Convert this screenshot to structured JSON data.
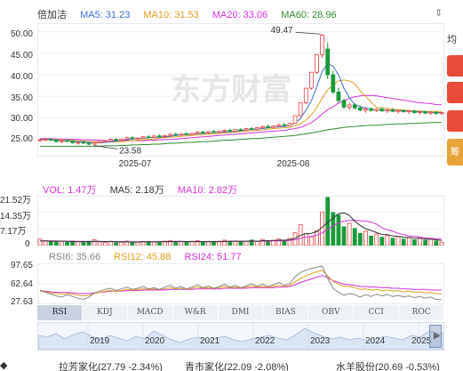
{
  "main_legend": {
    "name": "倍加洁",
    "items": [
      {
        "label": "MA5: 31.23",
        "color": "#3d6fd1"
      },
      {
        "label": "MA10: 31.53",
        "color": "#e0a020"
      },
      {
        "label": "MA20: 33.06",
        "color": "#d633d6"
      },
      {
        "label": "MA60: 28.96",
        "color": "#2f8a2f"
      }
    ]
  },
  "main_yaxis": [
    "50.00",
    "45.00",
    "40.00",
    "35.00",
    "30.00",
    "25.00"
  ],
  "main_xaxis": [
    "2025-07",
    "2025-08"
  ],
  "annotations": {
    "high": "49.47",
    "low": "23.58"
  },
  "watermark": "东方财富",
  "vol_legend": [
    {
      "label": "VOL: 1.47万",
      "color": "#d633d6"
    },
    {
      "label": "MA5: 2.18万",
      "color": "#333333"
    },
    {
      "label": "MA10: 2.82万",
      "color": "#d633d6"
    }
  ],
  "vol_yaxis": [
    "21.52万",
    "14.35万",
    "7.17万",
    "0"
  ],
  "rsi_legend": [
    {
      "label": "RSI6: 35.66",
      "color": "#888888"
    },
    {
      "label": "RSI12: 45.88",
      "color": "#e0a020"
    },
    {
      "label": "RSI24: 51.77",
      "color": "#d633d6"
    }
  ],
  "rsi_yaxis": [
    "97.65",
    "62.64",
    "27.63"
  ],
  "tabs": [
    "RSI",
    "KDJ",
    "MACD",
    "W&R",
    "DMI",
    "BIAS",
    "OBV",
    "CCI",
    "ROC"
  ],
  "navigator_years": [
    "2019",
    "2020",
    "2021",
    "2022",
    "2023",
    "2024",
    "2025"
  ],
  "side": {
    "label1": "均线",
    "label2": "筹"
  },
  "bottom": {
    "item1": "拉芳家化(27.79 -2.34%)",
    "item2": "青市家化(22.09 -2.08%)",
    "item3": "水羊股份(20.69 -0.53%)"
  },
  "chart_data": {
    "type": "candlestick",
    "ylim": [
      21,
      52
    ],
    "xlabels": [
      "2025-07",
      "2025-08"
    ],
    "candles": [
      [
        24.8,
        25.1,
        24.5,
        24.9
      ],
      [
        24.9,
        25.3,
        24.6,
        25.0
      ],
      [
        25.0,
        25.2,
        24.6,
        24.8
      ],
      [
        24.8,
        25.0,
        24.3,
        24.5
      ],
      [
        24.5,
        24.8,
        24.1,
        24.7
      ],
      [
        24.7,
        25.0,
        24.4,
        24.6
      ],
      [
        24.6,
        24.8,
        24.0,
        24.2
      ],
      [
        24.2,
        24.5,
        23.8,
        24.3
      ],
      [
        24.3,
        24.6,
        24.0,
        24.1
      ],
      [
        24.1,
        24.4,
        23.6,
        23.9
      ],
      [
        23.9,
        24.3,
        23.58,
        24.2
      ],
      [
        24.2,
        24.6,
        24.0,
        24.5
      ],
      [
        24.5,
        24.9,
        24.3,
        24.7
      ],
      [
        24.7,
        25.2,
        24.5,
        25.0
      ],
      [
        25.0,
        25.3,
        24.6,
        24.8
      ],
      [
        24.8,
        25.2,
        24.6,
        25.1
      ],
      [
        25.1,
        25.6,
        24.9,
        25.4
      ],
      [
        25.4,
        25.7,
        25.0,
        25.2
      ],
      [
        25.2,
        25.5,
        24.9,
        25.3
      ],
      [
        25.3,
        25.8,
        25.1,
        25.6
      ],
      [
        25.6,
        26.0,
        25.3,
        25.5
      ],
      [
        25.5,
        25.9,
        25.2,
        25.8
      ],
      [
        25.8,
        26.2,
        25.5,
        25.7
      ],
      [
        25.7,
        26.0,
        25.4,
        25.9
      ],
      [
        25.9,
        26.4,
        25.6,
        26.2
      ],
      [
        26.2,
        26.5,
        25.8,
        26.0
      ],
      [
        26.0,
        26.4,
        25.7,
        26.3
      ],
      [
        26.3,
        26.6,
        26.0,
        26.1
      ],
      [
        26.1,
        26.5,
        25.9,
        26.4
      ],
      [
        26.4,
        26.9,
        26.2,
        26.7
      ],
      [
        26.7,
        27.0,
        26.3,
        26.5
      ],
      [
        26.5,
        26.9,
        26.2,
        26.8
      ],
      [
        26.8,
        27.2,
        26.5,
        26.6
      ],
      [
        26.6,
        27.0,
        26.4,
        26.9
      ],
      [
        26.9,
        27.3,
        26.6,
        27.1
      ],
      [
        27.1,
        27.5,
        26.8,
        26.9
      ],
      [
        26.9,
        27.4,
        26.7,
        27.3
      ],
      [
        27.3,
        27.6,
        27.0,
        27.2
      ],
      [
        27.2,
        27.7,
        27.0,
        27.5
      ],
      [
        27.5,
        27.9,
        27.2,
        27.4
      ],
      [
        27.4,
        27.8,
        27.1,
        27.7
      ],
      [
        27.7,
        28.2,
        27.5,
        28.0
      ],
      [
        28.0,
        28.4,
        27.6,
        27.8
      ],
      [
        27.8,
        28.3,
        27.6,
        28.1
      ],
      [
        28.1,
        28.6,
        27.9,
        28.4
      ],
      [
        28.4,
        28.8,
        28.0,
        28.2
      ],
      [
        28.2,
        28.9,
        28.0,
        28.7
      ],
      [
        28.7,
        30.5,
        28.6,
        30.5
      ],
      [
        30.5,
        33.5,
        30.3,
        33.5
      ],
      [
        33.5,
        36.9,
        33.2,
        36.9
      ],
      [
        36.9,
        40.6,
        36.5,
        40.6
      ],
      [
        40.6,
        44.7,
        40.2,
        44.7
      ],
      [
        44.7,
        49.47,
        44.0,
        49.2
      ],
      [
        46.0,
        47.5,
        39.0,
        40.0
      ],
      [
        40.0,
        41.0,
        35.5,
        36.0
      ],
      [
        36.0,
        37.0,
        33.5,
        34.0
      ],
      [
        34.0,
        34.5,
        32.0,
        32.5
      ],
      [
        32.5,
        33.5,
        31.8,
        33.0
      ],
      [
        33.0,
        33.4,
        32.0,
        32.3
      ],
      [
        32.3,
        32.8,
        31.5,
        31.8
      ],
      [
        31.8,
        32.4,
        31.2,
        32.1
      ],
      [
        32.1,
        32.5,
        31.5,
        31.7
      ],
      [
        31.7,
        32.2,
        31.3,
        32.0
      ],
      [
        32.0,
        32.4,
        31.4,
        31.6
      ],
      [
        31.6,
        32.0,
        31.1,
        31.8
      ],
      [
        31.8,
        32.3,
        31.3,
        31.5
      ],
      [
        31.5,
        31.9,
        31.0,
        31.7
      ],
      [
        31.7,
        32.0,
        31.2,
        31.4
      ],
      [
        31.4,
        31.8,
        30.9,
        31.6
      ],
      [
        31.6,
        31.9,
        31.0,
        31.2
      ],
      [
        31.2,
        31.6,
        30.8,
        31.4
      ],
      [
        31.4,
        31.7,
        30.9,
        31.1
      ],
      [
        31.1,
        31.5,
        30.7,
        31.3
      ],
      [
        31.3,
        31.6,
        30.8,
        31.0
      ],
      [
        31.0,
        31.4,
        30.6,
        31.2
      ]
    ],
    "ma5": [
      25.0,
      24.9,
      24.9,
      24.8,
      24.7,
      24.7,
      24.6,
      24.5,
      24.4,
      24.3,
      24.2,
      24.2,
      24.3,
      24.4,
      24.6,
      24.8,
      24.9,
      25.1,
      25.2,
      25.3,
      25.4,
      25.5,
      25.5,
      25.6,
      25.7,
      25.9,
      26.0,
      26.1,
      26.2,
      26.3,
      26.4,
      26.5,
      26.6,
      26.6,
      26.7,
      26.8,
      26.9,
      27.0,
      27.2,
      27.3,
      27.4,
      27.5,
      27.7,
      27.8,
      27.9,
      28.0,
      28.2,
      28.8,
      29.9,
      31.8,
      34.0,
      37.2,
      40.8,
      42.6,
      42.0,
      40.0,
      36.9,
      34.7,
      33.1,
      32.6,
      32.3,
      32.0,
      31.9,
      31.8,
      31.8,
      31.7,
      31.7,
      31.6,
      31.6,
      31.5,
      31.4,
      31.4,
      31.3,
      31.2,
      31.2
    ],
    "ma10": [
      25.0,
      25.0,
      25.0,
      24.9,
      24.9,
      24.8,
      24.8,
      24.7,
      24.6,
      24.5,
      24.5,
      24.4,
      24.4,
      24.4,
      24.4,
      24.5,
      24.6,
      24.7,
      24.8,
      24.9,
      25.0,
      25.1,
      25.3,
      25.4,
      25.5,
      25.6,
      25.7,
      25.8,
      25.9,
      26.0,
      26.1,
      26.2,
      26.3,
      26.4,
      26.5,
      26.6,
      26.7,
      26.8,
      26.9,
      27.0,
      27.1,
      27.2,
      27.4,
      27.5,
      27.6,
      27.7,
      27.8,
      28.1,
      28.6,
      29.5,
      30.7,
      32.4,
      34.6,
      36.5,
      37.6,
      38.6,
      38.8,
      38.6,
      37.9,
      36.3,
      35.0,
      33.6,
      32.4,
      32.3,
      32.2,
      32.0,
      31.9,
      31.8,
      31.7,
      31.6,
      31.6,
      31.5,
      31.5,
      31.5,
      31.5
    ],
    "ma20": [
      25.2,
      25.2,
      25.2,
      25.1,
      25.1,
      25.1,
      25.0,
      25.0,
      24.9,
      24.9,
      24.8,
      24.8,
      24.7,
      24.7,
      24.7,
      24.7,
      24.7,
      24.7,
      24.7,
      24.7,
      24.8,
      24.8,
      24.9,
      24.9,
      25.0,
      25.1,
      25.2,
      25.3,
      25.4,
      25.5,
      25.6,
      25.7,
      25.8,
      25.9,
      26.0,
      26.1,
      26.2,
      26.3,
      26.4,
      26.5,
      26.6,
      26.7,
      26.8,
      26.9,
      27.0,
      27.1,
      27.3,
      27.5,
      27.8,
      28.3,
      28.9,
      29.8,
      30.9,
      31.9,
      32.6,
      33.4,
      34.0,
      34.5,
      34.9,
      35.1,
      35.2,
      35.2,
      35.1,
      34.9,
      34.7,
      34.5,
      34.3,
      34.1,
      33.9,
      33.7,
      33.5,
      33.4,
      33.3,
      33.1,
      33.06
    ],
    "ma60": [
      23.4,
      23.4,
      23.4,
      23.4,
      23.4,
      23.4,
      23.4,
      23.4,
      23.4,
      23.4,
      23.4,
      23.4,
      23.5,
      23.5,
      23.5,
      23.6,
      23.6,
      23.7,
      23.7,
      23.8,
      23.8,
      23.9,
      23.9,
      24.0,
      24.1,
      24.1,
      24.2,
      24.3,
      24.3,
      24.4,
      24.5,
      24.5,
      24.6,
      24.7,
      24.8,
      24.8,
      24.9,
      25.0,
      25.1,
      25.2,
      25.2,
      25.3,
      25.4,
      25.5,
      25.6,
      25.7,
      25.8,
      25.9,
      26.1,
      26.3,
      26.5,
      26.7,
      27.0,
      27.2,
      27.4,
      27.6,
      27.8,
      27.9,
      28.0,
      28.1,
      28.2,
      28.3,
      28.3,
      28.4,
      28.5,
      28.5,
      28.6,
      28.6,
      28.7,
      28.7,
      28.8,
      28.8,
      28.9,
      28.9,
      28.96
    ],
    "volume": [
      2.8,
      2.1,
      1.6,
      1.5,
      1.8,
      1.4,
      2.0,
      1.7,
      1.3,
      1.9,
      2.5,
      1.6,
      1.4,
      1.8,
      1.2,
      1.5,
      1.9,
      1.3,
      1.6,
      1.8,
      1.4,
      1.7,
      1.5,
      1.9,
      2.2,
      1.6,
      1.8,
      1.4,
      1.7,
      2.1,
      1.5,
      1.8,
      1.6,
      1.9,
      2.3,
      1.7,
      2.0,
      1.6,
      1.9,
      2.4,
      1.8,
      2.6,
      1.9,
      2.2,
      2.8,
      2.1,
      3.1,
      5.5,
      9.0,
      5.2,
      3.8,
      6.4,
      14.5,
      20.8,
      14.3,
      13.2,
      8.1,
      9.6,
      7.4,
      5.3,
      6.2,
      4.1,
      5.0,
      3.6,
      4.4,
      3.2,
      3.9,
      2.8,
      3.4,
      2.5,
      3.0,
      2.3,
      2.7,
      2.0,
      1.47
    ],
    "vol_ma5": [
      2.0,
      2.0,
      1.9,
      1.9,
      1.9,
      1.8,
      1.7,
      1.7,
      1.6,
      1.6,
      1.9,
      1.8,
      1.7,
      1.8,
      1.7,
      1.5,
      1.6,
      1.5,
      1.5,
      1.6,
      1.6,
      1.6,
      1.6,
      1.7,
      1.7,
      1.8,
      1.8,
      1.7,
      1.8,
      1.7,
      1.7,
      1.7,
      1.7,
      1.7,
      1.8,
      1.8,
      1.9,
      1.9,
      1.9,
      2.0,
      1.9,
      2.1,
      2.1,
      2.2,
      2.3,
      2.3,
      2.5,
      3.1,
      4.5,
      5.1,
      5.3,
      6.0,
      7.9,
      10.1,
      11.8,
      13.8,
      14.1,
      13.1,
      10.5,
      8.7,
      7.3,
      6.5,
      5.6,
      4.8,
      4.7,
      4.1,
      4.0,
      3.6,
      3.5,
      3.2,
      3.2,
      2.8,
      2.8,
      2.5,
      2.2
    ],
    "vol_ma10": [
      2.0,
      2.0,
      2.0,
      2.0,
      1.9,
      1.9,
      1.9,
      1.8,
      1.8,
      1.7,
      1.7,
      1.7,
      1.7,
      1.7,
      1.7,
      1.7,
      1.7,
      1.6,
      1.6,
      1.6,
      1.6,
      1.6,
      1.6,
      1.6,
      1.6,
      1.7,
      1.7,
      1.7,
      1.7,
      1.7,
      1.7,
      1.7,
      1.7,
      1.7,
      1.7,
      1.8,
      1.8,
      1.8,
      1.8,
      1.8,
      1.9,
      1.9,
      1.9,
      2.0,
      2.0,
      2.1,
      2.2,
      2.5,
      3.1,
      3.7,
      4.0,
      4.5,
      5.5,
      7.0,
      8.4,
      9.9,
      10.6,
      10.8,
      11.0,
      10.7,
      10.6,
      10.1,
      9.3,
      7.6,
      6.8,
      6.2,
      5.3,
      4.7,
      4.2,
      4.0,
      3.7,
      3.3,
      3.1,
      2.9,
      2.82
    ],
    "rsi6": [
      52,
      48,
      45,
      42,
      40,
      44,
      41,
      38,
      36,
      40,
      47,
      50,
      53,
      55,
      51,
      54,
      57,
      53,
      55,
      58,
      54,
      56,
      53,
      57,
      60,
      55,
      58,
      54,
      57,
      61,
      56,
      59,
      55,
      58,
      62,
      57,
      60,
      56,
      59,
      63,
      58,
      62,
      58,
      61,
      65,
      60,
      63,
      75,
      82,
      86,
      89,
      91,
      93,
      72,
      55,
      48,
      43,
      46,
      44,
      40,
      44,
      41,
      45,
      42,
      44,
      41,
      43,
      40,
      42,
      39,
      41,
      38,
      40,
      36,
      35.66
    ],
    "rsi12": [
      50,
      49,
      47,
      46,
      45,
      46,
      45,
      43,
      42,
      43,
      46,
      48,
      50,
      51,
      50,
      51,
      53,
      52,
      53,
      54,
      53,
      54,
      53,
      54,
      56,
      54,
      55,
      54,
      55,
      57,
      55,
      56,
      55,
      56,
      58,
      56,
      57,
      56,
      57,
      59,
      57,
      58,
      57,
      58,
      60,
      58,
      60,
      66,
      72,
      76,
      80,
      83,
      86,
      76,
      67,
      62,
      58,
      58,
      56,
      53,
      54,
      52,
      53,
      51,
      52,
      50,
      51,
      49,
      50,
      48,
      49,
      47,
      48,
      46,
      45.88
    ],
    "rsi24": [
      50,
      50,
      49,
      48,
      48,
      48,
      47,
      46,
      46,
      46,
      47,
      48,
      49,
      50,
      50,
      50,
      51,
      51,
      51,
      52,
      52,
      52,
      52,
      52,
      53,
      53,
      53,
      53,
      53,
      54,
      54,
      54,
      54,
      54,
      55,
      55,
      55,
      55,
      55,
      56,
      56,
      56,
      56,
      56,
      57,
      57,
      58,
      61,
      65,
      68,
      71,
      74,
      77,
      73,
      68,
      65,
      62,
      61,
      60,
      58,
      58,
      57,
      57,
      56,
      56,
      55,
      55,
      54,
      54,
      53,
      53,
      53,
      52,
      52,
      51.77
    ]
  }
}
